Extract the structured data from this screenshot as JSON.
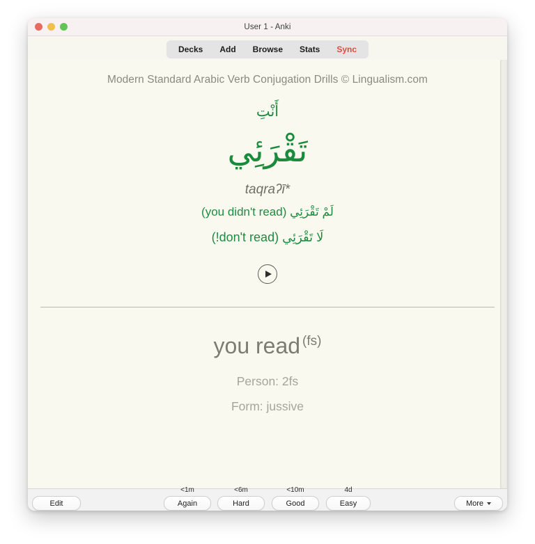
{
  "window": {
    "title": "User 1 - Anki",
    "traffic_lights": [
      {
        "name": "close",
        "color": "#e86a60"
      },
      {
        "name": "minimize",
        "color": "#f0bf4c"
      },
      {
        "name": "zoom",
        "color": "#61c555"
      }
    ]
  },
  "navbar": {
    "items": [
      {
        "label": "Decks",
        "accent": false
      },
      {
        "label": "Add",
        "accent": false
      },
      {
        "label": "Browse",
        "accent": false
      },
      {
        "label": "Stats",
        "accent": false
      },
      {
        "label": "Sync",
        "accent": true
      }
    ],
    "sync_color": "#e4483f"
  },
  "card": {
    "deck_subtitle": "Modern Standard Arabic Verb Conjugation Drills © Lingualism.com",
    "pronoun": "أَنْتِ",
    "verb": "تَقْرَئِي",
    "transliteration": "taqraʔī*",
    "gloss_line_1": "لَمْ تَقْرَئِي (you didn't read)",
    "gloss_line_2": "لَا تَقْرَئِي (don't read!)",
    "play_icon": "play-icon",
    "green_color": "#1a8a3c",
    "answer_text": "you read",
    "answer_superscript": "(fs)",
    "person": "Person: 2fs",
    "form": "Form: jussive"
  },
  "bottom_bar": {
    "edit_label": "Edit",
    "more_label": "More",
    "answer_buttons": [
      {
        "label": "Again",
        "interval": "<1m"
      },
      {
        "label": "Hard",
        "interval": "<6m"
      },
      {
        "label": "Good",
        "interval": "<10m"
      },
      {
        "label": "Easy",
        "interval": "4d"
      }
    ]
  }
}
